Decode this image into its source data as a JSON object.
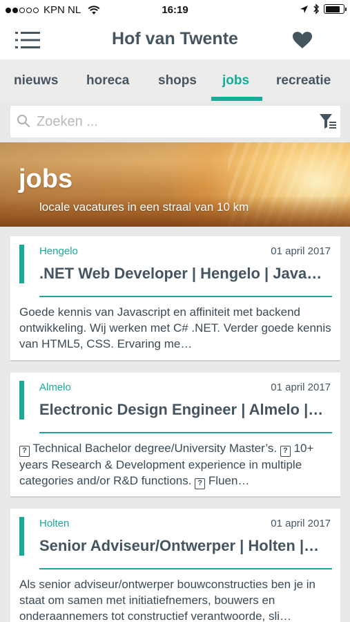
{
  "status_bar": {
    "carrier": "KPN NL",
    "time": "16:19"
  },
  "header": {
    "title": "Hof van Twente",
    "menu_icon": "hamburger-menu-icon",
    "favorite_icon": "heart-icon"
  },
  "tabs": [
    {
      "label": "nieuws",
      "active": false
    },
    {
      "label": "horeca",
      "active": false
    },
    {
      "label": "shops",
      "active": false
    },
    {
      "label": "jobs",
      "active": true
    },
    {
      "label": "recreatie",
      "active": false
    }
  ],
  "search": {
    "placeholder": "Zoeken ..."
  },
  "banner": {
    "title": "jobs",
    "subtitle": "locale vacatures in een straal van 10 km"
  },
  "jobs": [
    {
      "location": "Hengelo",
      "date": "01 april 2017",
      "title": ".NET Web Developer | Hengelo | Java…",
      "description": "Goede kennis van Javascript en affiniteit met backend ontwikkeling. Wij werken met C# .NET. Verder goede kennis van HTML5, CSS. Ervaring me…"
    },
    {
      "location": "Almelo",
      "date": "01 april 2017",
      "title": "Electronic Design Engineer | Almelo |…",
      "description_parts": [
        "?",
        " Technical Bachelor degree/University Master’s. ",
        "?",
        " 10+ years Research & Development experience in multiple categories and/or R&D functions. ",
        "?",
        " Fluen…"
      ]
    },
    {
      "location": "Holten",
      "date": "01 april 2017",
      "title": "Senior Adviseur/Ontwerper | Holten |…",
      "description": "Als senior adviseur/ontwerper bouwconstructies ben je in staat om samen met initiatiefnemers, bouwers en onderaannemers tot constructief verantwoorde, sli…"
    }
  ],
  "colors": {
    "accent": "#1aaa98",
    "text_dark": "#45555f",
    "background": "#e9e9e9"
  }
}
